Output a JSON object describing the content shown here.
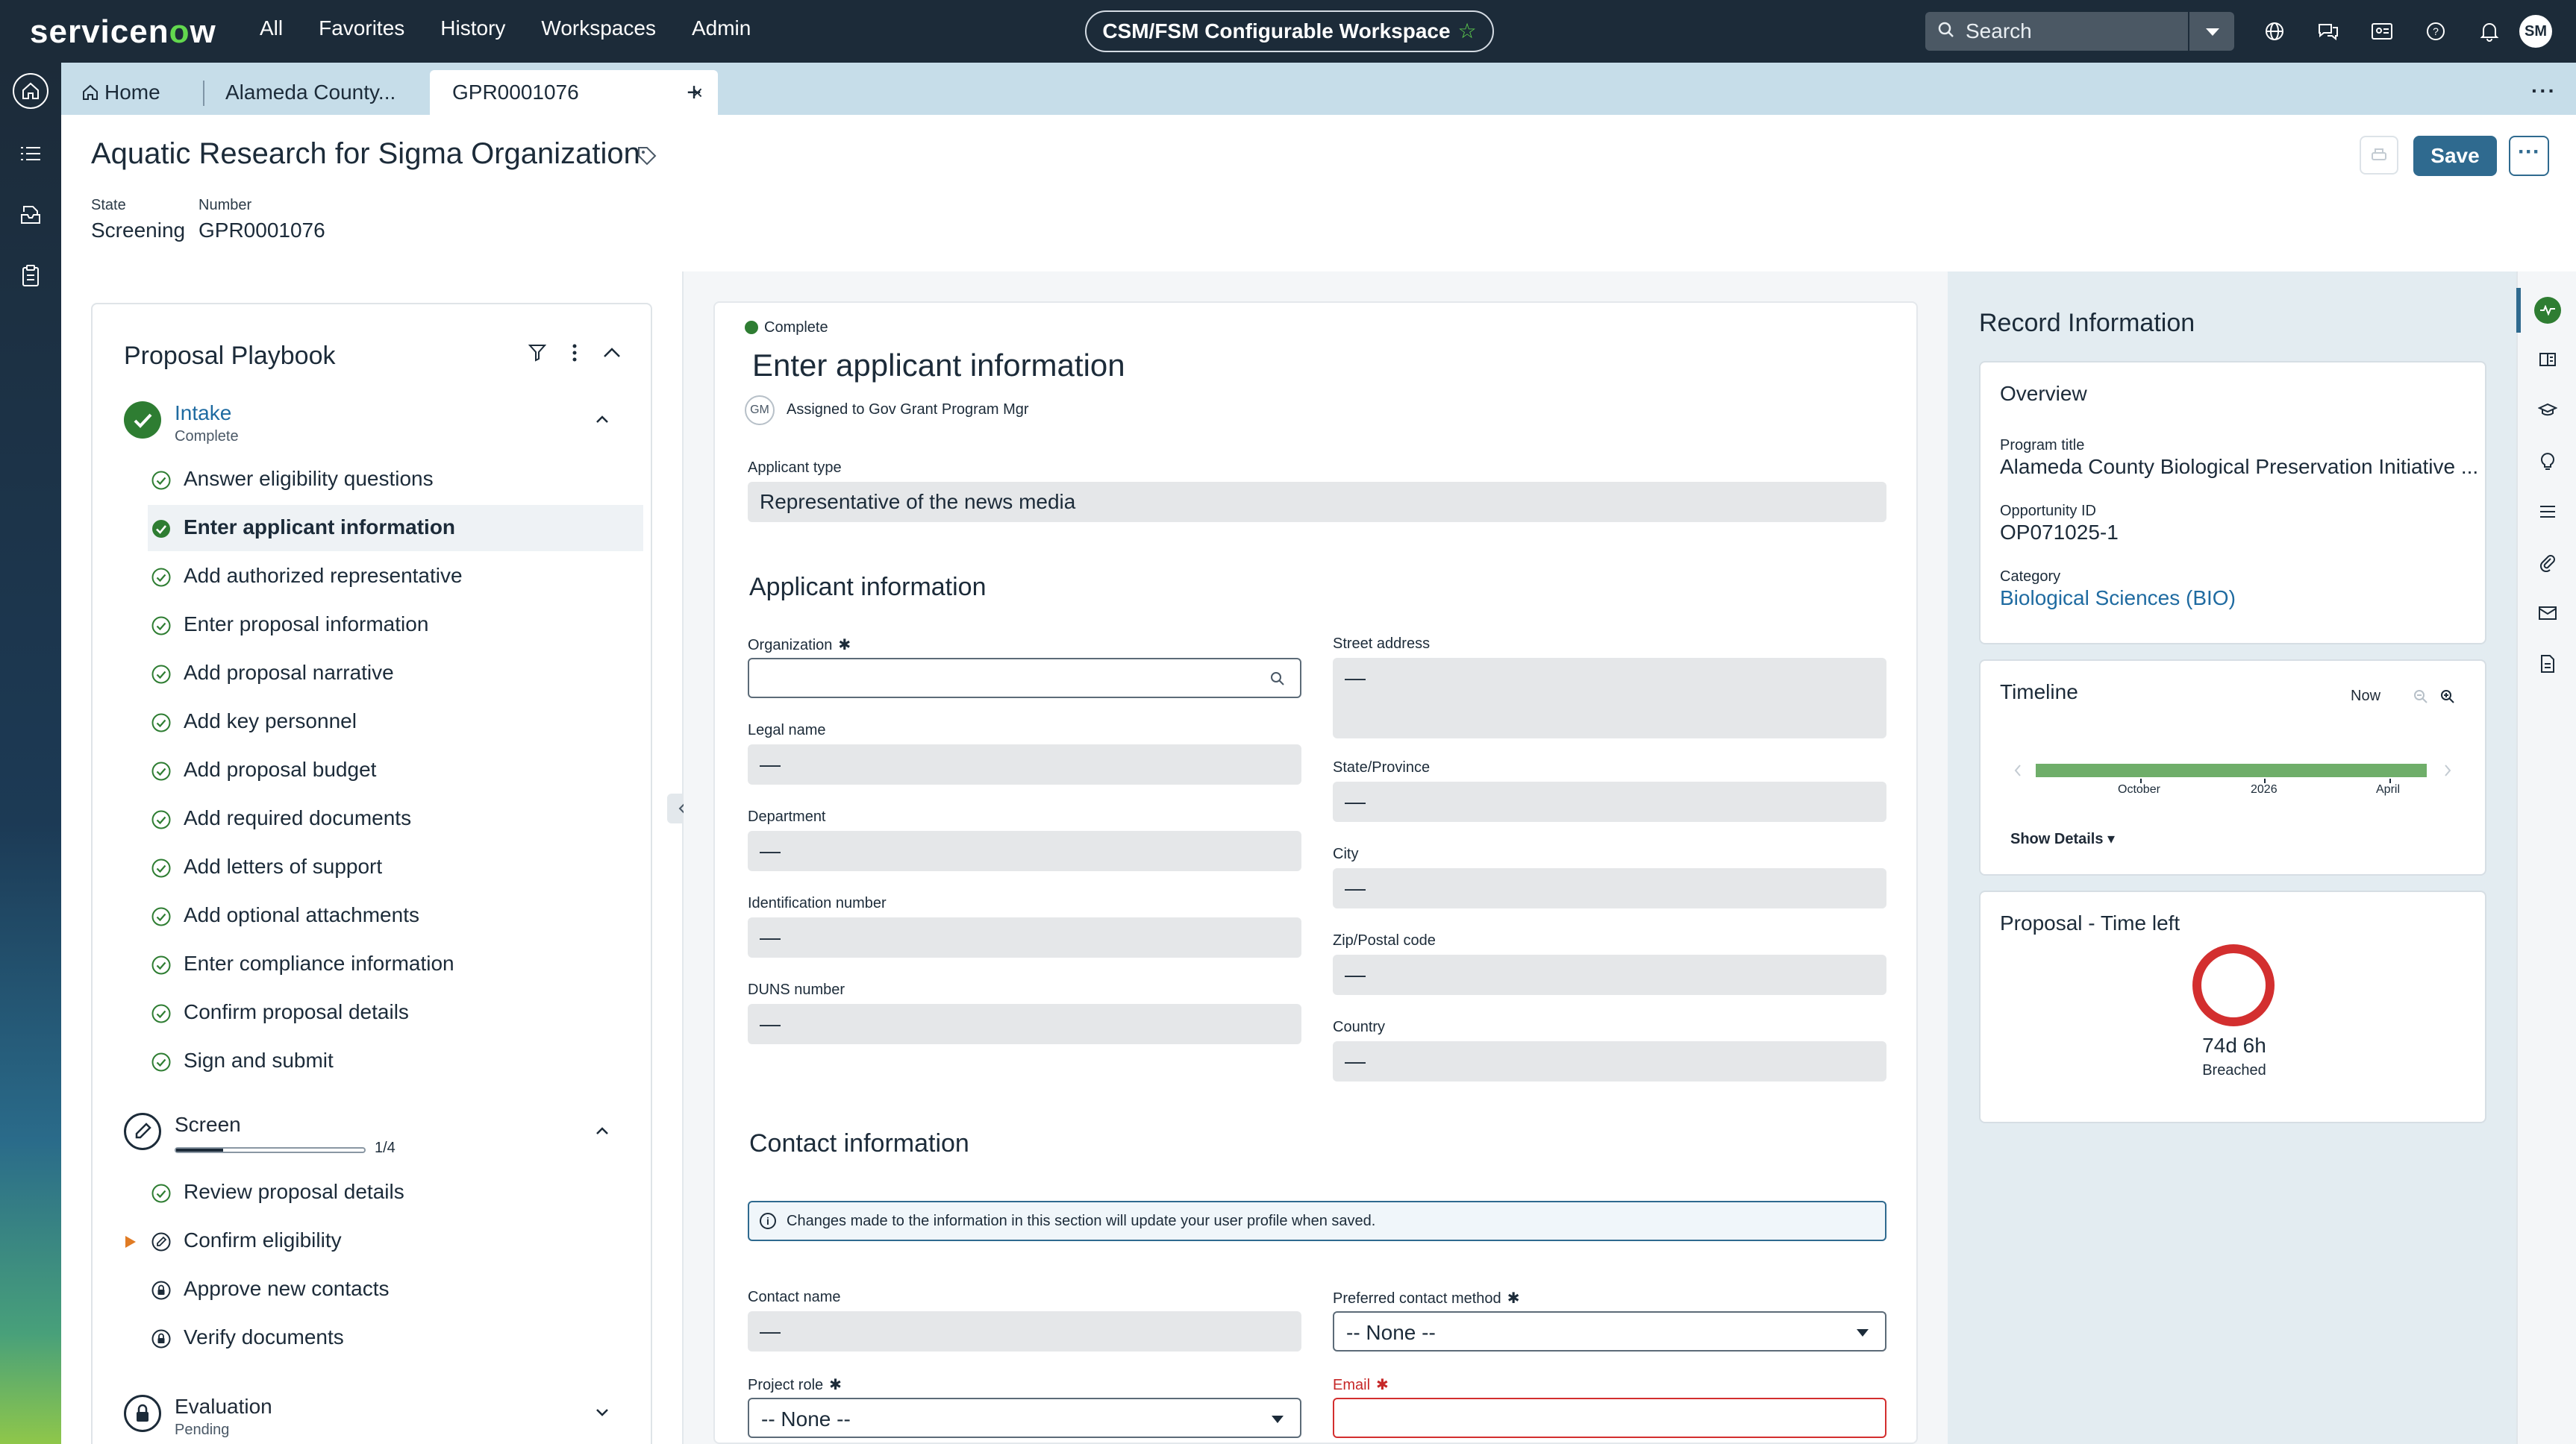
{
  "topbar": {
    "logo_prefix": "servicen",
    "logo_o": "o",
    "logo_suffix": "w",
    "nav": [
      "All",
      "Favorites",
      "History",
      "Workspaces",
      "Admin"
    ],
    "workspace_pill": "CSM/FSM Configurable Workspace",
    "search_placeholder": "Search",
    "avatar_initials": "SM",
    "icons": [
      "globe-icon",
      "chat-icon",
      "id-card-icon",
      "help-icon",
      "bell-icon"
    ]
  },
  "tabs": {
    "home": "Home",
    "items": [
      {
        "label": "Alameda County..."
      },
      {
        "label": "GPR0001076"
      }
    ],
    "close": "×",
    "add": "+"
  },
  "record": {
    "title": "Aquatic Research for Sigma Organization",
    "state_label": "State",
    "state_value": "Screening",
    "number_label": "Number",
    "number_value": "GPR0001076",
    "save_label": "Save",
    "more_label": "···"
  },
  "playbook": {
    "title": "Proposal Playbook",
    "stages": [
      {
        "name": "Intake",
        "status": "Complete",
        "activities": [
          "Answer eligibility questions",
          "Enter applicant information",
          "Add authorized representative",
          "Enter proposal information",
          "Add proposal narrative",
          "Add key personnel",
          "Add proposal budget",
          "Add required documents",
          "Add letters of support",
          "Add optional attachments",
          "Enter compliance information",
          "Confirm proposal details",
          "Sign and submit"
        ]
      },
      {
        "name": "Screen",
        "progress_label": "1/4",
        "progress_fraction": 0.25,
        "activities": [
          "Review proposal details",
          "Confirm eligibility",
          "Approve new contacts",
          "Verify documents"
        ]
      },
      {
        "name": "Evaluation",
        "status": "Pending"
      }
    ]
  },
  "form": {
    "status": "Complete",
    "title": "Enter applicant information",
    "assignee_initials": "GM",
    "assigned_text": "Assigned to Gov Grant Program Mgr",
    "applicant_type_label": "Applicant type",
    "applicant_type_value": "Representative of the news media",
    "section_applicant": "Applicant information",
    "organization_label": "Organization",
    "legal_name_label": "Legal name",
    "department_label": "Department",
    "identification_label": "Identification number",
    "duns_label": "DUNS number",
    "street_label": "Street address",
    "state_label": "State/Province",
    "city_label": "City",
    "zip_label": "Zip/Postal code",
    "country_label": "Country",
    "empty_value": "—",
    "required_mark": "✱",
    "section_contact": "Contact information",
    "banner_text": "Changes made to the information in this section will update your user profile when saved.",
    "contact_name_label": "Contact name",
    "preferred_method_label": "Preferred contact method",
    "preferred_method_value": "-- None --",
    "project_role_label": "Project role",
    "project_role_value": "-- None --",
    "email_label": "Email"
  },
  "record_info": {
    "title": "Record Information",
    "overview": {
      "title": "Overview",
      "program_title_label": "Program title",
      "program_title_value": "Alameda County Biological Preservation Initiative ...",
      "opportunity_label": "Opportunity ID",
      "opportunity_value": "OP071025-1",
      "category_label": "Category",
      "category_value": "Biological Sciences (BIO)"
    },
    "timeline": {
      "title": "Timeline",
      "now_label": "Now",
      "ticks": [
        "October",
        "2026",
        "April"
      ],
      "show_details": "Show Details ▾"
    },
    "time_left": {
      "title": "Proposal - Time left",
      "value": "74d 6h",
      "status": "Breached"
    }
  },
  "colors": {
    "topbar": "#1c2b39",
    "accent": "#2f6a8f",
    "complete_green": "#2e7d32",
    "breach_red": "#d32f2f",
    "timeline_green": "#6fae6a"
  }
}
